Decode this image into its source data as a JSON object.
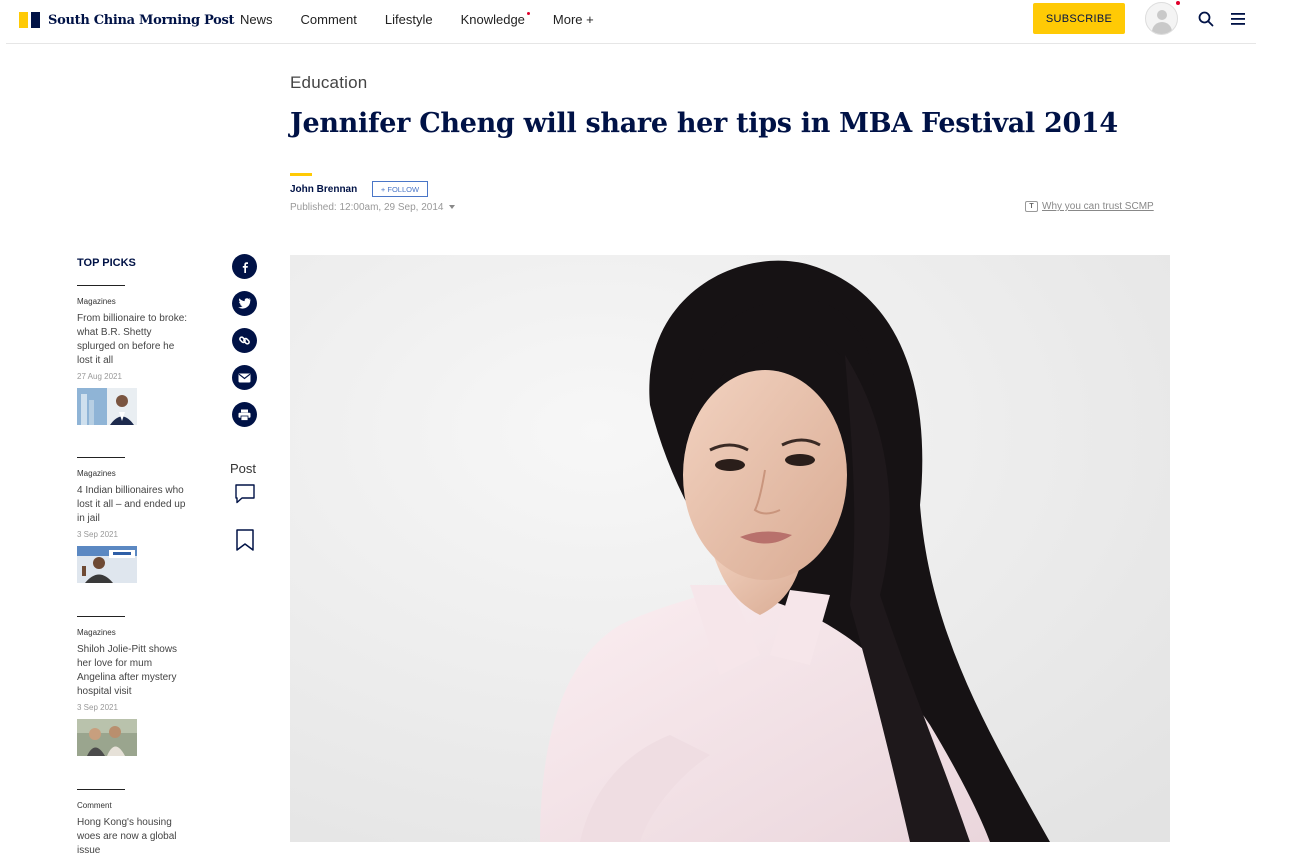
{
  "header": {
    "logo_text": "South China Morning Post",
    "nav": [
      "News",
      "Comment",
      "Lifestyle",
      "Knowledge",
      "More +"
    ],
    "subscribe_label": "SUBSCRIBE",
    "brand_yellow": "#FFCA05",
    "brand_navy": "#001246"
  },
  "article": {
    "section": "Education",
    "headline": "Jennifer Cheng will share her tips in MBA Festival 2014",
    "author": "John Brennan",
    "follow_label": "+ FOLLOW",
    "published": "Published: 12:00am, 29 Sep, 2014",
    "trust_label": "Why you can trust SCMP"
  },
  "top_picks": {
    "heading": "TOP PICKS",
    "items": [
      {
        "category": "Magazines",
        "title": "From billionaire to broke: what B.R. Shetty splurged on before he lost it all",
        "date": "27 Aug 2021"
      },
      {
        "category": "Magazines",
        "title": "4 Indian billionaires who lost it all – and ended up in jail",
        "date": "3 Sep 2021"
      },
      {
        "category": "Magazines",
        "title": "Shiloh Jolie-Pitt shows her love for mum Angelina after mystery hospital visit",
        "date": "3 Sep 2021"
      },
      {
        "category": "Comment",
        "title": "Hong Kong's housing woes are now a global issue",
        "date": ""
      }
    ]
  },
  "share": {
    "icons": [
      "facebook-icon",
      "twitter-icon",
      "link-icon",
      "email-icon",
      "print-icon"
    ],
    "post_label": "Post"
  }
}
